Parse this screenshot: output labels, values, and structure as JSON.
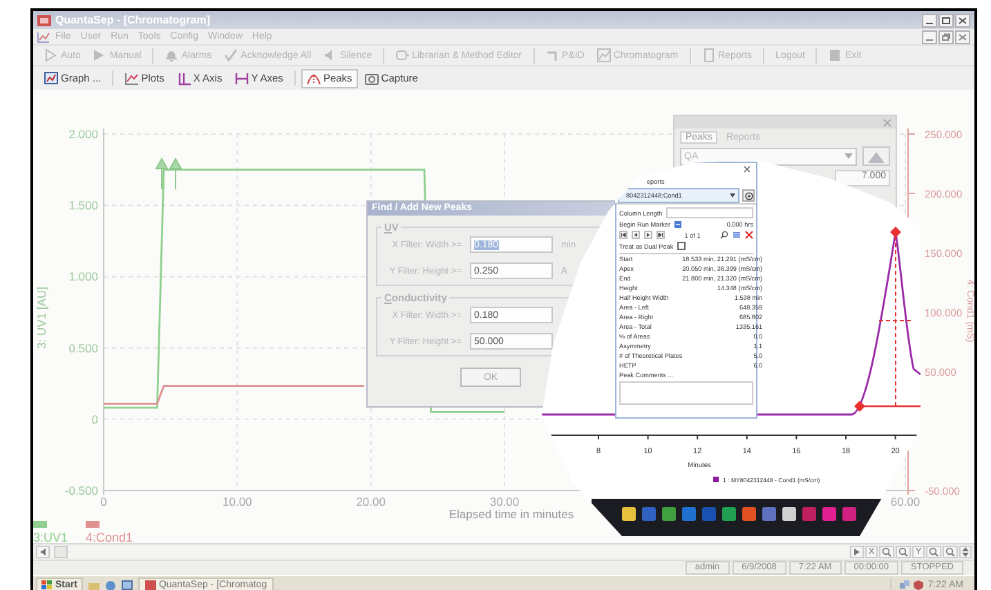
{
  "window": {
    "title": "QuantaSep - [Chromatogram]"
  },
  "menu": [
    "File",
    "User",
    "Run",
    "Tools",
    "Config",
    "Window",
    "Help"
  ],
  "toolbar": [
    [
      {
        "label": "Auto"
      },
      {
        "label": "Manual"
      }
    ],
    [
      {
        "label": "Alarms"
      },
      {
        "label": "Acknowledge All"
      },
      {
        "label": "Silence"
      }
    ],
    [
      {
        "label": "Librarian & Method Editor"
      }
    ],
    [
      {
        "label": "P&ID"
      },
      {
        "label": "Chromatogram"
      }
    ],
    [
      {
        "label": "Reports"
      }
    ],
    [
      {
        "label": "Logout"
      }
    ],
    [
      {
        "label": "Exit"
      }
    ]
  ],
  "graph_toolbar": [
    [
      {
        "label": "Graph ...",
        "selected": false
      }
    ],
    [
      {
        "label": "Plots",
        "selected": false
      },
      {
        "label": "X Axis",
        "selected": false
      },
      {
        "label": "Y Axes",
        "selected": false
      }
    ],
    [
      {
        "label": "Peaks",
        "selected": true
      },
      {
        "label": "Capture",
        "selected": false
      }
    ]
  ],
  "chart": {
    "chart_data": {
      "type": "line",
      "xlabel": "Elapsed time in minutes",
      "ylabel": "3: UV1 [AU]",
      "y2label": "4: Cond1 (mS)",
      "x": [
        0,
        4,
        4.5,
        19.5,
        24,
        24.5,
        30
      ],
      "grid": true,
      "legend": true,
      "series": [
        {
          "name": "3:UV1",
          "color": "#8fd08f",
          "values": [
            0.08,
            0.08,
            1.75,
            1.75,
            1.75,
            0.05,
            0.05
          ]
        },
        {
          "name": "4:Cond1",
          "color": "#e09090",
          "axis": "y2",
          "values": [
            23,
            23,
            38,
            38,
            null,
            null,
            null
          ]
        }
      ],
      "xlim": [
        0,
        60
      ],
      "ylim": [
        -0.5,
        2
      ],
      "y2lim": [
        -50,
        250
      ],
      "xticks": [
        {
          "value": 0,
          "label": "0"
        },
        {
          "value": 10,
          "label": "10.00"
        },
        {
          "value": 20,
          "label": "20.00"
        },
        {
          "value": 30,
          "label": "30.00"
        },
        {
          "value": 60,
          "label": "60.00"
        }
      ],
      "yticks": [
        {
          "value": 2,
          "label": "2.000"
        },
        {
          "value": 1.5,
          "label": "1.500"
        },
        {
          "value": 1,
          "label": "1.000"
        },
        {
          "value": 0.5,
          "label": "0.500"
        },
        {
          "value": 0,
          "label": "0"
        },
        {
          "value": -0.5,
          "label": "-0.500"
        }
      ],
      "y2ticks": [
        {
          "value": 250,
          "label": "250.000"
        },
        {
          "value": 200,
          "label": "200.000"
        },
        {
          "value": 150,
          "label": "150.000"
        },
        {
          "value": 100,
          "label": "100.000"
        },
        {
          "value": 50,
          "label": "50.000"
        },
        {
          "value": -50,
          "label": "-50.000"
        }
      ]
    }
  },
  "dialog": {
    "title": "Find / Add New Peaks",
    "groups": [
      {
        "title": "UV",
        "fields": [
          {
            "label": "X Filter: Width >=",
            "value": "0.180",
            "selected": true,
            "unit": "min"
          },
          {
            "label": "Y Filter: Height >=",
            "value": "0.250",
            "selected": false,
            "unit": "A"
          }
        ]
      },
      {
        "title": "Conductivity",
        "fields": [
          {
            "label": "X Filter: Width >=",
            "value": "0.180",
            "selected": false
          },
          {
            "label": "Y Filter: Height >=",
            "value": "50.000",
            "selected": false
          }
        ]
      }
    ],
    "ok": "OK"
  },
  "peaks_panel": {
    "tabs": [
      {
        "label": "Peaks",
        "selected": true
      },
      {
        "label": "Reports",
        "selected": false
      }
    ],
    "plot_select": "QA",
    "value": "7.000"
  },
  "inset": {
    "tab": "eports",
    "plot_select": "8042312448:Cond1",
    "column_length": "Column Length",
    "begin_run_marker": {
      "label": "Begin Run Marker",
      "value": "0.000 hrs"
    },
    "pager": "1 of 1",
    "dual_peak": {
      "label": "Treat as Dual Peak",
      "checked": false
    },
    "rows": [
      {
        "name": "Start",
        "value": "18.533 min, 21.291 (mS/cm)"
      },
      {
        "name": "Apex",
        "value": "20.050 min, 36.399 (mS/cm)"
      },
      {
        "name": "End",
        "value": "21.800 min, 21.320 (mS/cm)"
      },
      {
        "name": "Height",
        "value": "14.348 (mS/cm)"
      },
      {
        "name": "Half Height Width",
        "value": "1.538 min"
      },
      {
        "name": "Area - Left",
        "value": "648.359"
      },
      {
        "name": "Area - Right",
        "value": "685.802"
      },
      {
        "name": "Area - Total",
        "value": "1335.161"
      },
      {
        "name": "% of Areas",
        "value": "0.0"
      },
      {
        "name": "Asymmetry",
        "value": "1.1"
      },
      {
        "name": "# of Theoretical Plates",
        "value": "5.0"
      },
      {
        "name": "HETP",
        "value": "6.0"
      }
    ],
    "comments_label": "Peak Comments ...",
    "x_tick_labels": [
      "8",
      "10",
      "12",
      "14",
      "16",
      "18",
      "20"
    ],
    "x_axis_title": "Minutes",
    "legend": "1 : MY8042312448 - Cond1 (mS/cm)"
  },
  "zoom_bar": {
    "x_label": "X",
    "y_label": "Y"
  },
  "status_bar": [
    "admin",
    "6/9/2008",
    "7:22 AM",
    "00:00:00",
    "STOPPED"
  ],
  "taskbar": {
    "start": "Start",
    "tasks": [
      "QuantaSep - [Chromatog"
    ],
    "clock": "7:22 AM"
  }
}
